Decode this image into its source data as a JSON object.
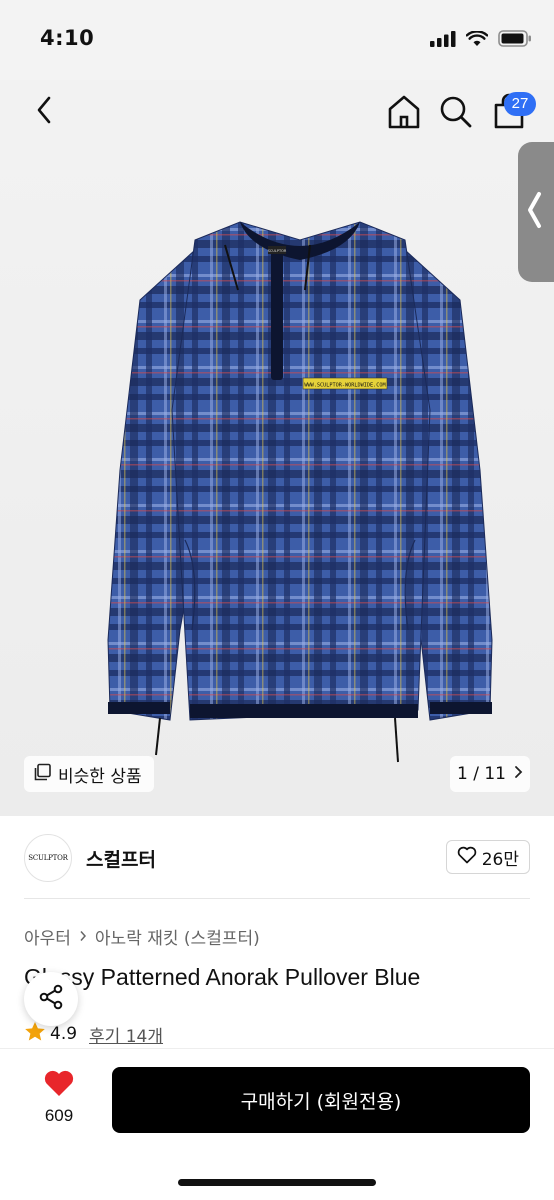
{
  "status_bar": {
    "time": "4:10"
  },
  "header": {
    "cart_count": "27"
  },
  "hero": {
    "similar_label": "비슷한 상품",
    "pager": "1 / 11",
    "jacket_print_text": "WWW.SCULPTOR-WORLDWIDE.COM",
    "jacket_tag_text": "SCULPTOR"
  },
  "brand": {
    "logo_text": "SCULPTOR",
    "name": "스컬프터",
    "likes": "26만"
  },
  "breadcrumb": {
    "items": [
      "아우터",
      "아노락 재킷 (스컬프터)"
    ]
  },
  "product": {
    "title": "Glossy Patterned Anorak Pullover Blue",
    "rating": "4.9",
    "review_label": "후기 14개"
  },
  "bottom_bar": {
    "heart_count": "609",
    "buy_label": "구매하기 (회원전용)"
  },
  "colors": {
    "accent": "#2f6ff5",
    "heart": "#e8262b",
    "star": "#f2a20a",
    "jacket": "#3d5da8"
  },
  "icons": [
    "back-icon",
    "home-icon",
    "search-icon",
    "bag-icon",
    "chevron-left-icon",
    "similar-icon",
    "chevron-right-icon",
    "heart-outline-icon",
    "star-icon",
    "share-icon",
    "heart-filled-icon"
  ]
}
